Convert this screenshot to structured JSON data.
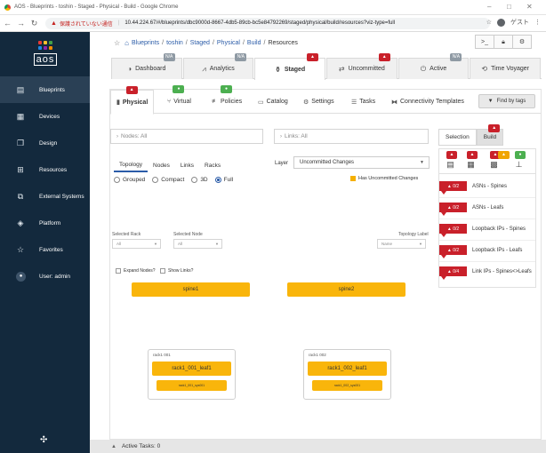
{
  "browser": {
    "title": "AOS - Blueprints - toshin - Staged - Physical - Build - Google Chrome",
    "insecure_label": "保護されていない通信",
    "url": "10.44.224.67/#/blueprints/dbc9000d-8667-4db5-89cb-bc5e84792269/staged/physical/build/resources?viz-type=full",
    "profile_label": "ゲスト"
  },
  "sidebar": {
    "logo_text": "aos",
    "items": [
      {
        "label": "Blueprints",
        "icon": "blueprints-icon"
      },
      {
        "label": "Devices",
        "icon": "devices-icon"
      },
      {
        "label": "Design",
        "icon": "design-icon"
      },
      {
        "label": "Resources",
        "icon": "resources-icon"
      },
      {
        "label": "External Systems",
        "icon": "external-systems-icon"
      },
      {
        "label": "Platform",
        "icon": "platform-icon"
      },
      {
        "label": "Favorites",
        "icon": "star-icon"
      },
      {
        "label": "User: admin",
        "icon": "user-icon"
      }
    ]
  },
  "breadcrumb": [
    "Blueprints",
    "toshin",
    "Staged",
    "Physical",
    "Build",
    "Resources"
  ],
  "main_tabs": [
    {
      "label": "Dashboard",
      "badge": "N/A"
    },
    {
      "label": "Analytics",
      "badge": "N/A"
    },
    {
      "label": "Staged",
      "badge": "alert"
    },
    {
      "label": "Uncommitted",
      "badge": "alert"
    },
    {
      "label": "Active",
      "badge": "N/A"
    },
    {
      "label": "Time Voyager",
      "badge": ""
    }
  ],
  "sub_tabs": [
    {
      "label": "Physical"
    },
    {
      "label": "Virtual"
    },
    {
      "label": "Policies"
    },
    {
      "label": "Catalog"
    },
    {
      "label": "Settings"
    },
    {
      "label": "Tasks"
    },
    {
      "label": "Connectivity Templates"
    }
  ],
  "find_by_tags": "Find by tags",
  "nodes_field": "Nodes: All",
  "links_field": "Links: All",
  "selection_label": "Selection",
  "build_label": "Build",
  "topology_tabs": [
    "Topology",
    "Nodes",
    "Links",
    "Racks"
  ],
  "view_modes": [
    "Grouped",
    "Compact",
    "3D",
    "Full"
  ],
  "layer": {
    "label": "Layer",
    "value": "Uncommitted Changes"
  },
  "has_uncommitted": "Has Uncommitted Changes",
  "selected_rack": {
    "label": "Selected Rack",
    "value": "All"
  },
  "selected_node": {
    "label": "Selected Node",
    "value": "All"
  },
  "topology_label": {
    "label": "Topology Label",
    "value": "Name"
  },
  "expand_nodes": "Expand Nodes?",
  "show_links": "Show Links?",
  "spines": [
    "spine1",
    "spine2"
  ],
  "racks": [
    {
      "title": "rack1 001",
      "leaf": "rack1_001_leaf1",
      "server": "rack1_001_sys001"
    },
    {
      "title": "rack1 002",
      "leaf": "rack1_002_leaf1",
      "server": "rack1_002_sys001"
    }
  ],
  "build_items": [
    {
      "count": "0/2",
      "label": "ASNs - Spines"
    },
    {
      "count": "0/2",
      "label": "ASNs - Leafs"
    },
    {
      "count": "0/2",
      "label": "Loopback IPs - Spines"
    },
    {
      "count": "0/2",
      "label": "Loopback IPs - Leafs"
    },
    {
      "count": "0/4",
      "label": "Link IPs - Spines<>Leafs"
    }
  ],
  "footer": {
    "active_tasks": "Active Tasks: 0"
  },
  "colors": {
    "sidebar": "#13293d",
    "accent": "#2b5ca8",
    "node": "#f9b50b",
    "alert": "#c9202a"
  }
}
